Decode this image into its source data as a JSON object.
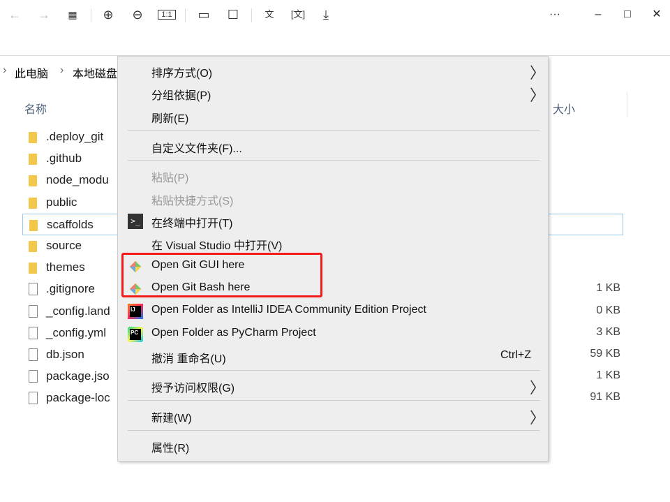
{
  "toolbar": {
    "icons": [
      "back-icon",
      "forward-icon",
      "grid-icon",
      "zoom-in-icon",
      "zoom-out-icon",
      "actual-size-icon",
      "rotate-icon",
      "edit-icon",
      "translate-icon",
      "ocr-icon",
      "download-icon"
    ]
  },
  "window": {
    "more": "···",
    "minimize": "–",
    "maximize": "□",
    "close": "✕"
  },
  "breadcrumb": [
    "此电脑",
    "本地磁盘"
  ],
  "columns": {
    "name": "名称",
    "size": "大小"
  },
  "files": [
    {
      "name": ".deploy_git",
      "type": "folder",
      "size": ""
    },
    {
      "name": ".github",
      "type": "folder",
      "size": ""
    },
    {
      "name": "node_modu",
      "type": "folder",
      "size": ""
    },
    {
      "name": "public",
      "type": "folder",
      "size": ""
    },
    {
      "name": "scaffolds",
      "type": "folder",
      "size": "",
      "selected": true
    },
    {
      "name": "source",
      "type": "folder",
      "size": ""
    },
    {
      "name": "themes",
      "type": "folder",
      "size": ""
    },
    {
      "name": ".gitignore",
      "type": "file",
      "size": "1 KB"
    },
    {
      "name": "_config.land",
      "type": "file",
      "size": "0 KB"
    },
    {
      "name": "_config.yml",
      "type": "file",
      "size": "3 KB"
    },
    {
      "name": "db.json",
      "type": "file",
      "size": "59 KB"
    },
    {
      "name": "package.jso",
      "type": "file",
      "size": "1 KB"
    },
    {
      "name": "package-loc",
      "type": "file",
      "size": "91 KB"
    }
  ],
  "menu": {
    "sort": "排序方式(O)",
    "group": "分组依据(P)",
    "refresh": "刷新(E)",
    "customize": "自定义文件夹(F)...",
    "paste": "粘贴(P)",
    "paste_shortcut": "粘贴快捷方式(S)",
    "terminal": "在终端中打开(T)",
    "vs": "在 Visual Studio 中打开(V)",
    "git_gui": "Open Git GUI here",
    "git_bash": "Open Git Bash here",
    "intellij": "Open Folder as IntelliJ IDEA Community Edition Project",
    "pycharm": "Open Folder as PyCharm Project",
    "undo": "撤消 重命名(U)",
    "undo_shortcut": "Ctrl+Z",
    "grant": "授予访问权限(G)",
    "new": "新建(W)",
    "properties": "属性(R)",
    "arrow": "〉"
  },
  "highlight_color": "#f21c1c"
}
